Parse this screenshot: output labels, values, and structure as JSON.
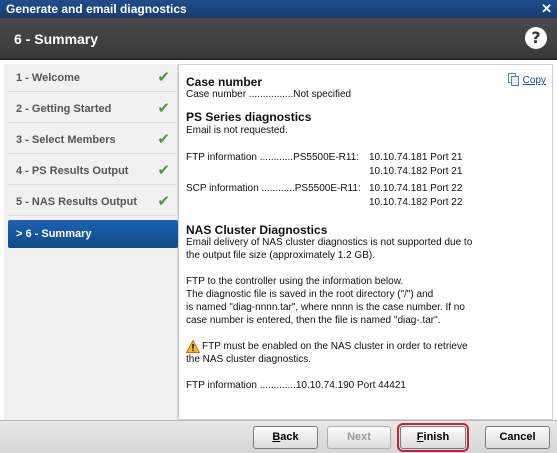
{
  "window": {
    "title": "Generate and email diagnostics"
  },
  "header": {
    "step_title": "6 - Summary",
    "help_glyph": "?"
  },
  "sidebar": {
    "items": [
      {
        "label": "1 - Welcome",
        "done": true
      },
      {
        "label": "2 - Getting Started",
        "done": true
      },
      {
        "label": "3 - Select Members",
        "done": true
      },
      {
        "label": "4 - PS Results Output",
        "done": true
      },
      {
        "label": "5 - NAS Results Output",
        "done": true
      },
      {
        "label": ">  6 - Summary",
        "done": false,
        "active": true
      }
    ]
  },
  "content": {
    "copy_label": "Copy",
    "case_heading": "Case number",
    "case_line": "Case number ................Not specified",
    "ps_heading": "PS Series diagnostics",
    "email_line": "Email is not requested.",
    "ftp_label": "FTP information ............PS5500E-R11:",
    "ftp_ip1": "10.10.74.181 Port 21",
    "ftp_ip2": "10.10.74.182 Port 21",
    "scp_label": "SCP information ............PS5500E-R11:",
    "scp_ip1": "10.10.74.181 Port 22",
    "scp_ip2": "10.10.74.182 Port 22",
    "nas_heading": "NAS Cluster Diagnostics",
    "nas_p1_l1": "Email delivery of NAS cluster diagnostics is not supported due to",
    "nas_p1_l2": "the output file size (approximately 1.2 GB).",
    "nas_p2_l1": "FTP to the controller using the information below.",
    "nas_p2_l2": "The diagnostic file is saved in the root directory (\"/\") and",
    "nas_p2_l3": "is named \"diag-nnnn.tar\", where nnnn is the case number. If no",
    "nas_p2_l4": "case number is entered, then the file is named \"diag-.tar\".",
    "warn_l1": "FTP must be enabled on the NAS cluster in order to retrieve",
    "warn_l2": "the NAS cluster diagnostics.",
    "nas_ftp_line": "FTP information .............10.10.74.190 Port 44421"
  },
  "footer": {
    "back_label": "ack",
    "back_key": "B",
    "next_label": "Next",
    "finish_label": "inish",
    "finish_key": "F",
    "cancel_label": "Cancel"
  },
  "colors": {
    "accent": "#1b63b2",
    "check": "#4a9a2e",
    "finish_outline": "#c8203a",
    "link": "#1a4fb5"
  }
}
